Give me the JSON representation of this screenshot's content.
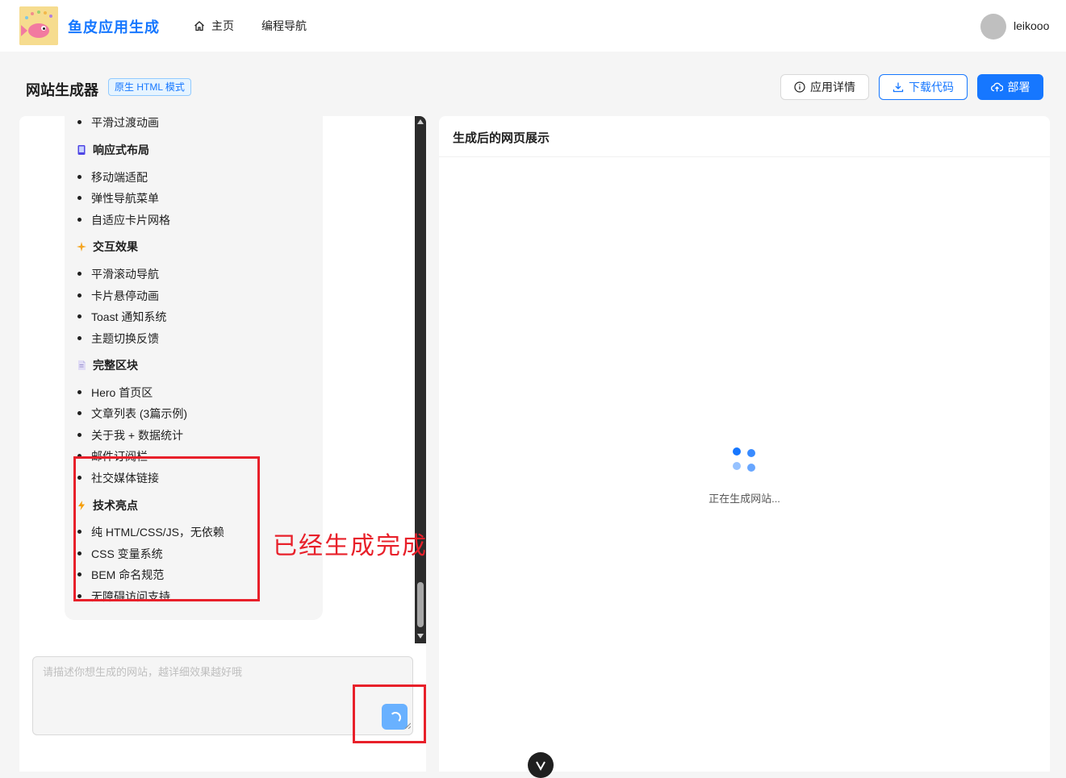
{
  "app": {
    "brand": "鱼皮应用生成",
    "nav": [
      {
        "label": "主页",
        "icon": "home-icon"
      },
      {
        "label": "编程导航"
      }
    ],
    "user": {
      "name": "leikooo"
    }
  },
  "header": {
    "title": "网站生成器",
    "mode_tag": "原生 HTML 模式",
    "buttons": {
      "detail": "应用详情",
      "download": "下载代码",
      "deploy": "部署"
    }
  },
  "chat": {
    "lines": {
      "l0": "平滑过渡动画",
      "h1": "响应式布局",
      "l1": "移动端适配",
      "l2": "弹性导航菜单",
      "l3": "自适应卡片网格",
      "h2": "交互效果",
      "l4": "平滑滚动导航",
      "l5": "卡片悬停动画",
      "l6": "Toast 通知系统",
      "l7": "主题切换反馈",
      "h3": "完整区块",
      "l8": "Hero 首页区",
      "l9": "文章列表 (3篇示例)",
      "l10": "关于我 + 数据统计",
      "l11": "邮件订阅栏",
      "l12": "社交媒体链接",
      "h4": "技术亮点",
      "l13": "纯 HTML/CSS/JS，无依赖",
      "l14": "CSS 变量系统",
      "l15": "BEM 命名规范",
      "l16": "无障碍访问支持"
    },
    "input_placeholder": "请描述你想生成的网站，越详细效果越好哦"
  },
  "preview": {
    "title": "生成后的网页展示",
    "loading_text": "正在生成网站..."
  },
  "annotation": {
    "text": "已经生成完成",
    "color": "#e8202a"
  },
  "colors": {
    "primary": "#1677ff",
    "panel_bg": "#ffffff",
    "page_bg": "#f5f5f5"
  }
}
